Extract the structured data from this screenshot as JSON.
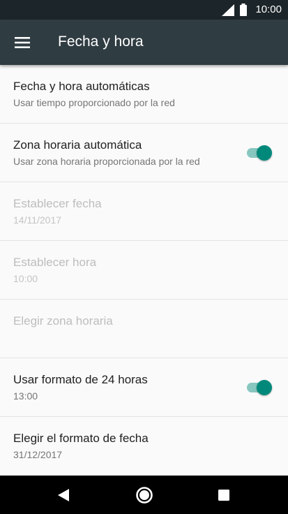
{
  "status_bar": {
    "time": "10:00"
  },
  "toolbar": {
    "title": "Fecha y hora"
  },
  "settings": [
    {
      "title": "Fecha y hora automáticas",
      "summary": "Usar tiempo proporcionado por la red"
    },
    {
      "title": "Zona horaria automática",
      "summary": "Usar zona horaria proporcionada por la red",
      "toggle": "on"
    },
    {
      "title": "Establecer fecha",
      "summary": "14/11/2017",
      "enabled": false
    },
    {
      "title": "Establecer hora",
      "summary": "10:00",
      "enabled": false
    },
    {
      "title": "Elegir zona horaria",
      "enabled": false
    },
    {
      "title": "Usar formato de 24 horas",
      "summary": "13:00",
      "toggle": "on"
    },
    {
      "title": "Elegir el formato de fecha",
      "summary": "31/12/2017"
    }
  ],
  "colors": {
    "toolbar": "#2f3c42",
    "status_bar": "#1c2529",
    "accent": "#00897b"
  },
  "icons": [
    "signal-icon",
    "battery-icon",
    "menu-icon",
    "back-icon",
    "home-icon",
    "recent-apps-icon"
  ]
}
